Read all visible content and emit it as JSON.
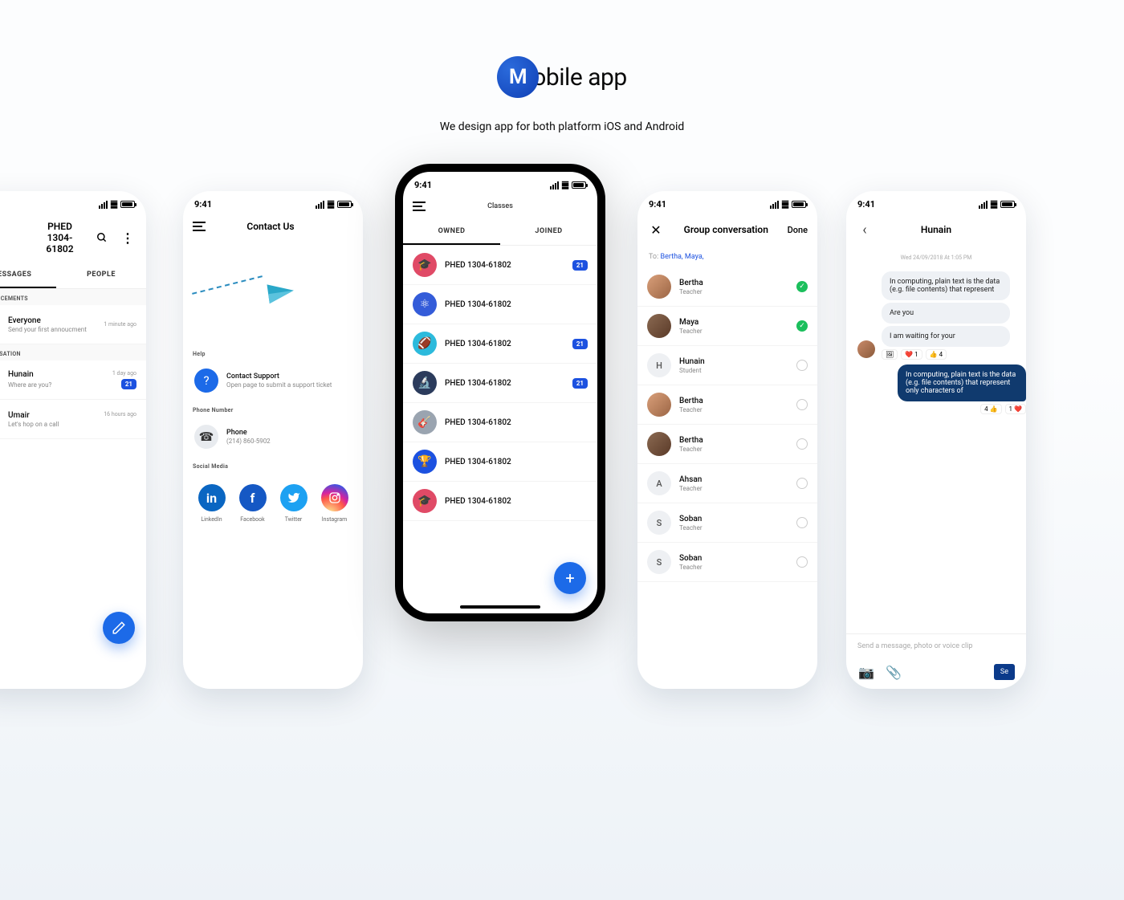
{
  "hero": {
    "logo_letter": "M",
    "logo_text": "obile app",
    "subtitle": "We design app for both platform iOS and Android"
  },
  "status": {
    "time": "9:41"
  },
  "screen1": {
    "title": "PHED 1304-61802",
    "tab_messages": "MESSAGES",
    "tab_people": "PEOPLE",
    "sec_announcements": "ANNOUNCEMENTS",
    "ann_title": "Everyone",
    "ann_sub": "Send your first annoucment",
    "ann_time": "1 minute ago",
    "sec_conversation": "CONVERSATION",
    "conv1_title": "Hunain",
    "conv1_sub": "Where are you?",
    "conv1_time": "1 day ago",
    "conv1_badge": "21",
    "conv2_title": "Umair",
    "conv2_sub": "Let's hop on a call",
    "conv2_time": "16 hours ago"
  },
  "screen2": {
    "title": "Contact Us",
    "sec_help": "Help",
    "help_title": "Contact Support",
    "help_sub": "Open page to submit a support ticket",
    "sec_phone": "Phone Number",
    "phone_title": "Phone",
    "phone_sub": "(214) 860-5902",
    "sec_social": "Social Media",
    "social_li": "LinkedIn",
    "social_fb": "Facebook",
    "social_tw": "Twitter",
    "social_ig": "Instagram"
  },
  "screen3": {
    "title": "Classes",
    "tab_owned": "OWNED",
    "tab_joined": "JOINED",
    "class_label": "PHED 1304-61802",
    "badge": "21"
  },
  "screen4": {
    "title": "Group conversation",
    "done": "Done",
    "to_label": "To:",
    "to_recipients": "Bertha, Maya,",
    "p1_name": "Bertha",
    "p1_role": "Teacher",
    "p2_name": "Maya",
    "p2_role": "Teacher",
    "p3_name": "Hunain",
    "p3_role": "Student",
    "p4_name": "Bertha",
    "p4_role": "Teacher",
    "p5_name": "Bertha",
    "p5_role": "Teacher",
    "p6_name": "Ahsan",
    "p6_role": "Teacher",
    "p7_name": "Soban",
    "p7_role": "Teacher",
    "p8_name": "Soban",
    "p8_role": "Teacher"
  },
  "screen5": {
    "title": "Hunain",
    "date": "Wed 24/09/2018 At 1:05 PM",
    "msg1": "In computing, plain text is the data (e.g. file contents) that represent",
    "msg2": "Are you",
    "msg3": "I am waiting for your",
    "react_heart": "1",
    "react_thumb": "4",
    "msg4": "In computing, plain text is the data (e.g. file contents) that represent only characters of",
    "react2_thumb": "4",
    "react2_heart": "1",
    "placeholder": "Send a message, photo or voice clip",
    "send": "Se"
  }
}
